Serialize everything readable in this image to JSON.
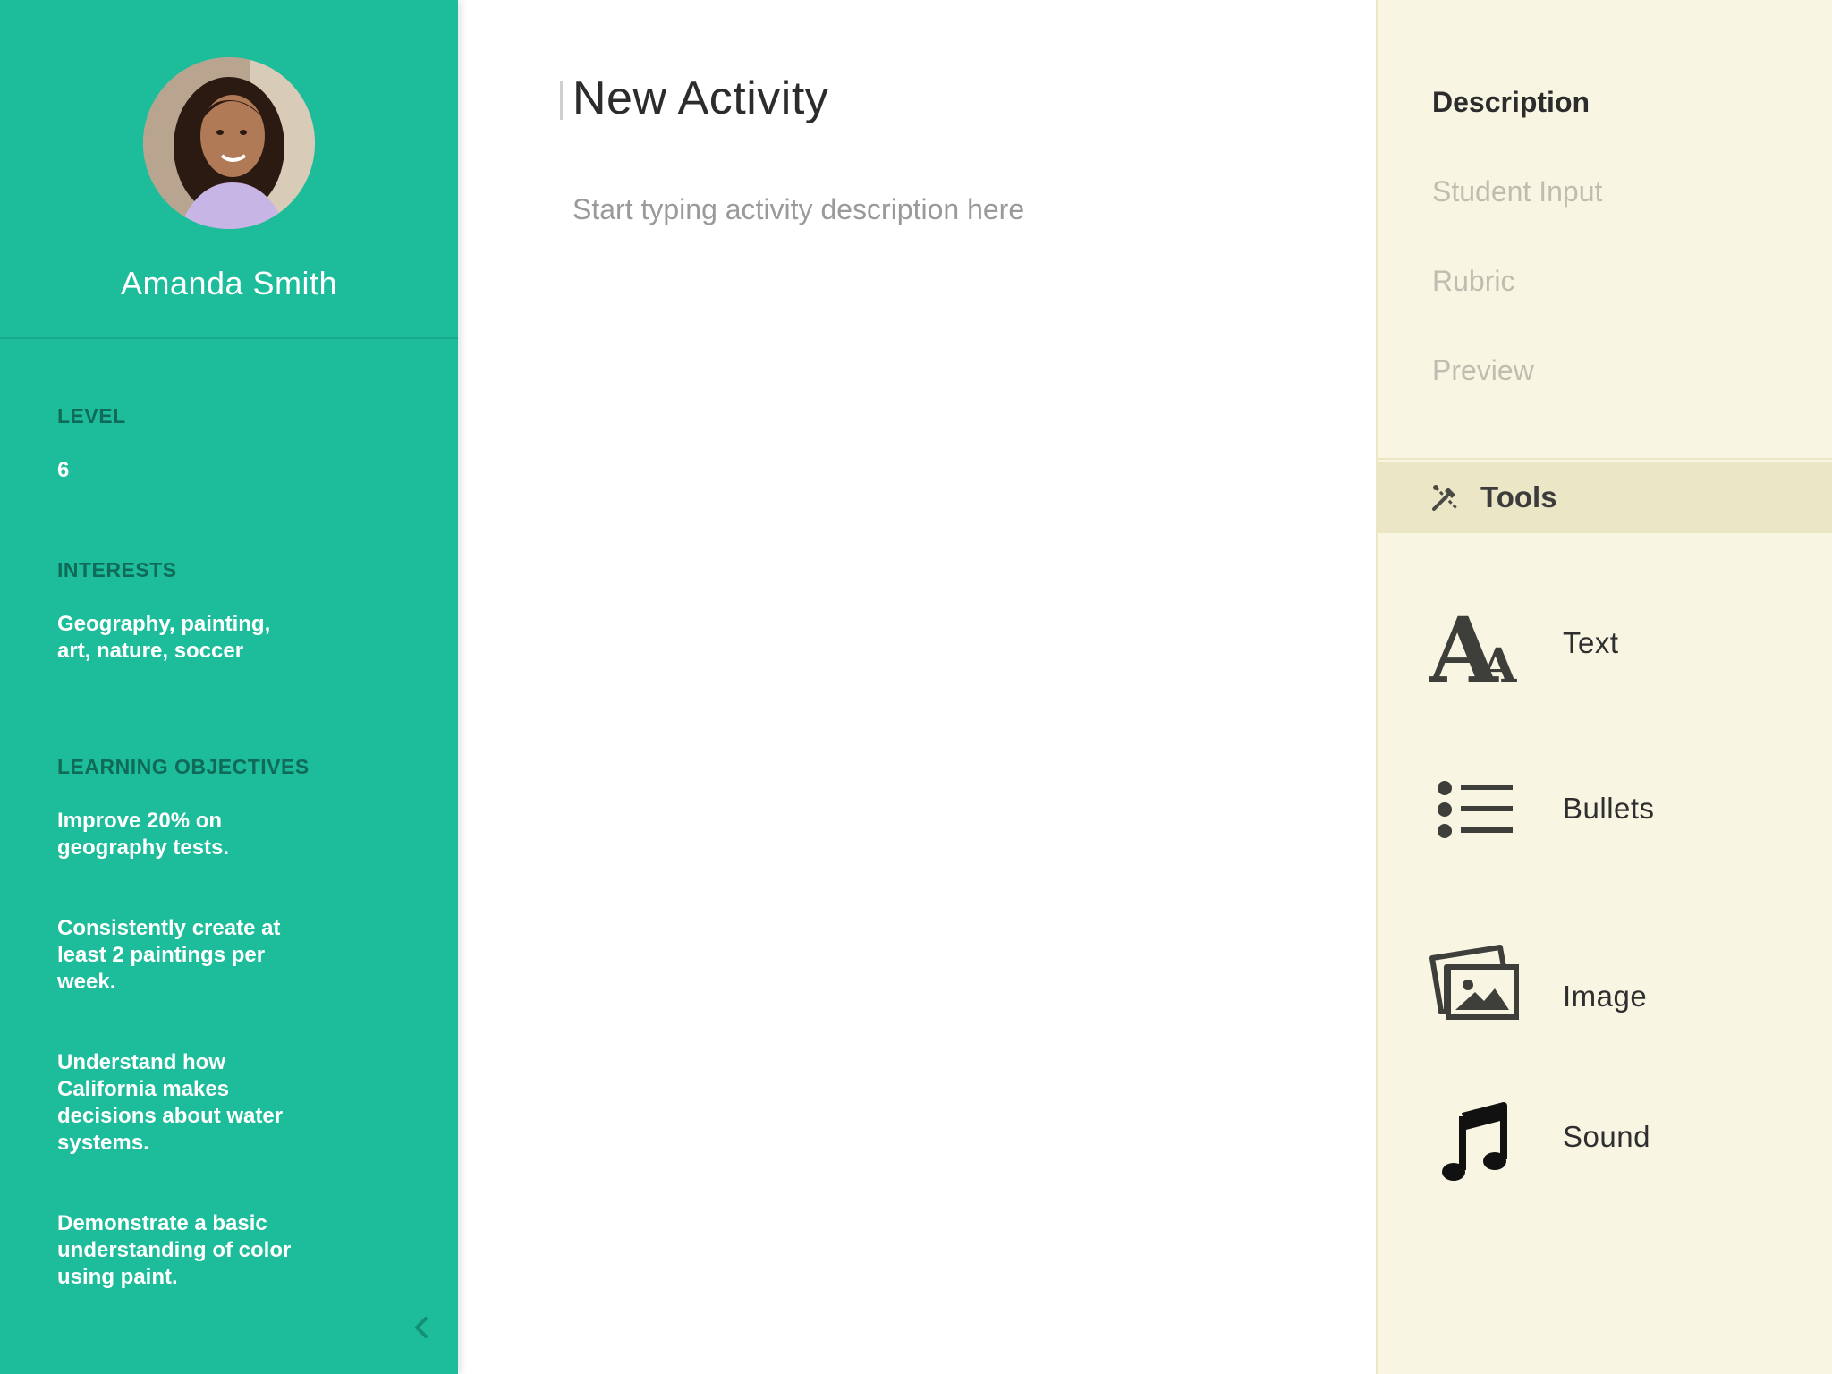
{
  "profile": {
    "name": "Amanda Smith",
    "level_label": "LEVEL",
    "level_value": "6",
    "interests_label": "INTERESTS",
    "interests_value": "Geography, painting, art, nature, soccer",
    "objectives_label": "LEARNING OBJECTIVES",
    "objectives": [
      "Improve 20% on geography tests.",
      "Consistently create at least 2 paintings per week.",
      "Understand how California makes decisions about water systems.",
      "Demonstrate a basic understanding of color using paint."
    ]
  },
  "editor": {
    "title": "New Activity",
    "description_placeholder": "Start typing activity description here"
  },
  "panel": {
    "nav": [
      {
        "label": "Description",
        "active": true
      },
      {
        "label": "Student Input",
        "active": false
      },
      {
        "label": "Rubric",
        "active": false
      },
      {
        "label": "Preview",
        "active": false
      }
    ],
    "tools_label": "Tools",
    "tools": [
      {
        "label": "Text",
        "icon": "text-format-icon"
      },
      {
        "label": "Bullets",
        "icon": "bulleted-list-icon"
      },
      {
        "label": "Image",
        "icon": "image-stack-icon"
      },
      {
        "label": "Sound",
        "icon": "music-note-icon"
      }
    ]
  },
  "colors": {
    "sidebar": "#1dbc9a",
    "sidebar_label": "#0f6b58",
    "panel": "#f8f5e2",
    "tools_bar": "#ebe6c6"
  }
}
